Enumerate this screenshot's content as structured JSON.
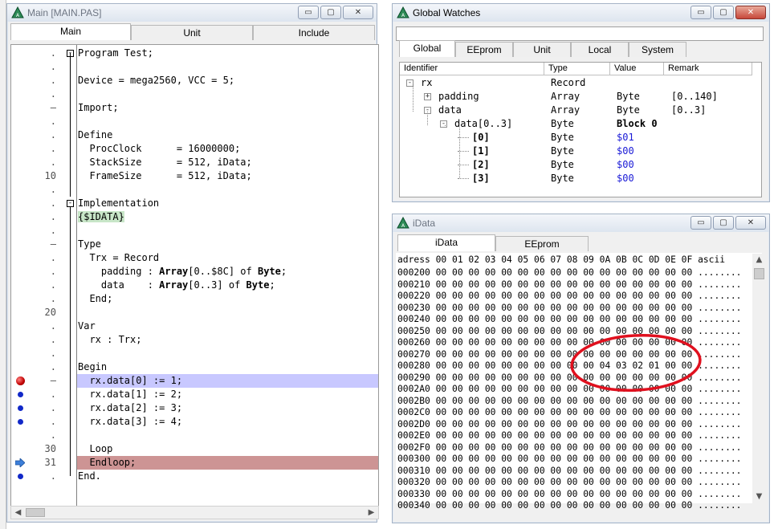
{
  "main_window": {
    "title": "Main [MAIN.PAS]",
    "tabs": [
      "Main",
      "Unit",
      "Include"
    ],
    "code_lines": [
      {
        "gutter": ".",
        "marker": "",
        "fold": "-",
        "text": [
          {
            "t": "Program Test;"
          }
        ]
      },
      {
        "gutter": ".",
        "marker": "",
        "fold": "",
        "text": [
          {
            "t": ""
          }
        ]
      },
      {
        "gutter": ".",
        "marker": "",
        "fold": "",
        "text": [
          {
            "t": "Device = mega2560, VCC = 5;"
          }
        ]
      },
      {
        "gutter": ".",
        "marker": "",
        "fold": "",
        "text": [
          {
            "t": ""
          }
        ]
      },
      {
        "gutter": "–",
        "marker": "",
        "fold": "",
        "text": [
          {
            "t": "Import;"
          }
        ]
      },
      {
        "gutter": ".",
        "marker": "",
        "fold": "",
        "text": [
          {
            "t": ""
          }
        ]
      },
      {
        "gutter": ".",
        "marker": "",
        "fold": "",
        "text": [
          {
            "t": "Define"
          }
        ]
      },
      {
        "gutter": ".",
        "marker": "",
        "fold": "",
        "text": [
          {
            "t": "  ProcClock      = 16000000;"
          }
        ]
      },
      {
        "gutter": ".",
        "marker": "",
        "fold": "",
        "text": [
          {
            "t": "  StackSize      = 512, iData;"
          }
        ]
      },
      {
        "gutter": "10",
        "marker": "",
        "fold": "",
        "text": [
          {
            "t": "  FrameSize      = 512, iData;"
          }
        ]
      },
      {
        "gutter": ".",
        "marker": "",
        "fold": "",
        "text": [
          {
            "t": ""
          }
        ]
      },
      {
        "gutter": ".",
        "marker": "",
        "fold": "-",
        "text": [
          {
            "t": "Implementation"
          }
        ]
      },
      {
        "gutter": ".",
        "marker": "",
        "fold": "",
        "text": [
          {
            "t": "{$IDATA}",
            "c": "dir"
          }
        ]
      },
      {
        "gutter": ".",
        "marker": "",
        "fold": "",
        "text": [
          {
            "t": ""
          }
        ]
      },
      {
        "gutter": "–",
        "marker": "",
        "fold": "",
        "text": [
          {
            "t": "Type"
          }
        ]
      },
      {
        "gutter": ".",
        "marker": "",
        "fold": "",
        "text": [
          {
            "t": "  Trx = Record"
          }
        ]
      },
      {
        "gutter": ".",
        "marker": "",
        "fold": "",
        "text": [
          {
            "t": "    padding : "
          },
          {
            "t": "Array",
            "c": "kw"
          },
          {
            "t": "[0..$8C] of "
          },
          {
            "t": "Byte",
            "c": "kw"
          },
          {
            "t": ";"
          }
        ]
      },
      {
        "gutter": ".",
        "marker": "",
        "fold": "",
        "text": [
          {
            "t": "    data    : "
          },
          {
            "t": "Array",
            "c": "kw"
          },
          {
            "t": "[0..3] of "
          },
          {
            "t": "Byte",
            "c": "kw"
          },
          {
            "t": ";"
          }
        ]
      },
      {
        "gutter": ".",
        "marker": "",
        "fold": "",
        "text": [
          {
            "t": "  End;"
          }
        ]
      },
      {
        "gutter": "20",
        "marker": "",
        "fold": "",
        "text": [
          {
            "t": ""
          }
        ]
      },
      {
        "gutter": ".",
        "marker": "",
        "fold": "",
        "text": [
          {
            "t": "Var"
          }
        ]
      },
      {
        "gutter": ".",
        "marker": "",
        "fold": "",
        "text": [
          {
            "t": "  rx : Trx;"
          }
        ]
      },
      {
        "gutter": ".",
        "marker": "",
        "fold": "",
        "text": [
          {
            "t": ""
          }
        ]
      },
      {
        "gutter": ".",
        "marker": "",
        "fold": "",
        "text": [
          {
            "t": "Begin"
          }
        ]
      },
      {
        "gutter": "–",
        "marker": "breakpoint",
        "fold": "",
        "hl": "blue",
        "text": [
          {
            "t": "  rx.data[0] := 1;"
          }
        ]
      },
      {
        "gutter": ".",
        "marker": "dot",
        "fold": "",
        "text": [
          {
            "t": "  rx.data[1] := 2;"
          }
        ]
      },
      {
        "gutter": ".",
        "marker": "dot",
        "fold": "",
        "text": [
          {
            "t": "  rx.data[2] := 3;"
          }
        ]
      },
      {
        "gutter": ".",
        "marker": "dot",
        "fold": "",
        "text": [
          {
            "t": "  rx.data[3] := 4;"
          }
        ]
      },
      {
        "gutter": ".",
        "marker": "",
        "fold": "",
        "text": [
          {
            "t": ""
          }
        ]
      },
      {
        "gutter": "30",
        "marker": "",
        "fold": "",
        "text": [
          {
            "t": "  Loop"
          }
        ]
      },
      {
        "gutter": "31",
        "marker": "arrow",
        "fold": "",
        "hl": "red",
        "text": [
          {
            "t": "  Endloop;"
          }
        ]
      },
      {
        "gutter": ".",
        "marker": "dot",
        "fold": "",
        "text": [
          {
            "t": "End."
          }
        ]
      }
    ]
  },
  "watches_window": {
    "title": "Global Watches",
    "watch_input": "",
    "tabs": [
      "Global",
      "EEprom",
      "Unit",
      "Local",
      "System"
    ],
    "columns": [
      "Identifier",
      "Type",
      "Value",
      "Remark"
    ],
    "rows": [
      {
        "id": "rx",
        "type": "Record",
        "value": "",
        "remark": "",
        "level": 0,
        "toggle": "-"
      },
      {
        "id": "padding",
        "type": "Array",
        "value": "Byte",
        "remark": "[0..140]",
        "level": 1,
        "toggle": "+"
      },
      {
        "id": "data",
        "type": "Array",
        "value": "Byte",
        "remark": "[0..3]",
        "level": 1,
        "toggle": "-"
      },
      {
        "id": "data[0..3]",
        "type": "Byte",
        "value": "Block 0",
        "remark": "",
        "level": 2,
        "toggle": "-",
        "bold_value": true
      },
      {
        "id": "[0]",
        "type": "Byte",
        "value": "$01",
        "remark": "",
        "level": 3,
        "toggle": "",
        "blue": true
      },
      {
        "id": "[1]",
        "type": "Byte",
        "value": "$00",
        "remark": "",
        "level": 3,
        "toggle": "",
        "blue": true
      },
      {
        "id": "[2]",
        "type": "Byte",
        "value": "$00",
        "remark": "",
        "level": 3,
        "toggle": "",
        "blue": true
      },
      {
        "id": "[3]",
        "type": "Byte",
        "value": "$00",
        "remark": "",
        "level": 3,
        "toggle": "",
        "blue": true
      }
    ]
  },
  "idata_window": {
    "title": "iData",
    "tabs": [
      "iData",
      "EEprom"
    ],
    "header": "adress 00 01 02 03 04 05 06 07 08 09 0A 0B 0C 0D 0E 0F ascii",
    "rows": [
      "000200 00 00 00 00 00 00 00 00 00 00 00 00 00 00 00 00 ........",
      "000210 00 00 00 00 00 00 00 00 00 00 00 00 00 00 00 00 ........",
      "000220 00 00 00 00 00 00 00 00 00 00 00 00 00 00 00 00 ........",
      "000230 00 00 00 00 00 00 00 00 00 00 00 00 00 00 00 00 ........",
      "000240 00 00 00 00 00 00 00 00 00 00 00 00 00 00 00 00 ........",
      "000250 00 00 00 00 00 00 00 00 00 00 00 00 00 00 00 00 ........",
      "000260 00 00 00 00 00 00 00 00 00 00 00 00 00 00 00 00 ........",
      "000270 00 00 00 00 00 00 00 00 00 00 00 00 00 00 00 00 ........",
      "000280 00 00 00 00 00 00 00 00 00 00 04 03 02 01 00 00 ........",
      "000290 00 00 00 00 00 00 00 00 00 00 00 00 00 00 00 00 ........",
      "0002A0 00 00 00 00 00 00 00 00 00 00 00 00 00 00 00 00 ........",
      "0002B0 00 00 00 00 00 00 00 00 00 00 00 00 00 00 00 00 ........",
      "0002C0 00 00 00 00 00 00 00 00 00 00 00 00 00 00 00 00 ........",
      "0002D0 00 00 00 00 00 00 00 00 00 00 00 00 00 00 00 00 ........",
      "0002E0 00 00 00 00 00 00 00 00 00 00 00 00 00 00 00 00 ........",
      "0002F0 00 00 00 00 00 00 00 00 00 00 00 00 00 00 00 00 ........",
      "000300 00 00 00 00 00 00 00 00 00 00 00 00 00 00 00 00 ........",
      "000310 00 00 00 00 00 00 00 00 00 00 00 00 00 00 00 00 ........",
      "000320 00 00 00 00 00 00 00 00 00 00 00 00 00 00 00 00 ........",
      "000330 00 00 00 00 00 00 00 00 00 00 00 00 00 00 00 00 ........",
      "000340 00 00 00 00 00 00 00 00 00 00 00 00 00 00 00 00 ........"
    ],
    "annotation_color": "#e0101e"
  },
  "icons": {
    "min": "▭",
    "max": "▢",
    "close": "✕",
    "scroll_left": "◀",
    "scroll_right": "▶",
    "scroll_up": "▲",
    "scroll_down": "▼"
  }
}
